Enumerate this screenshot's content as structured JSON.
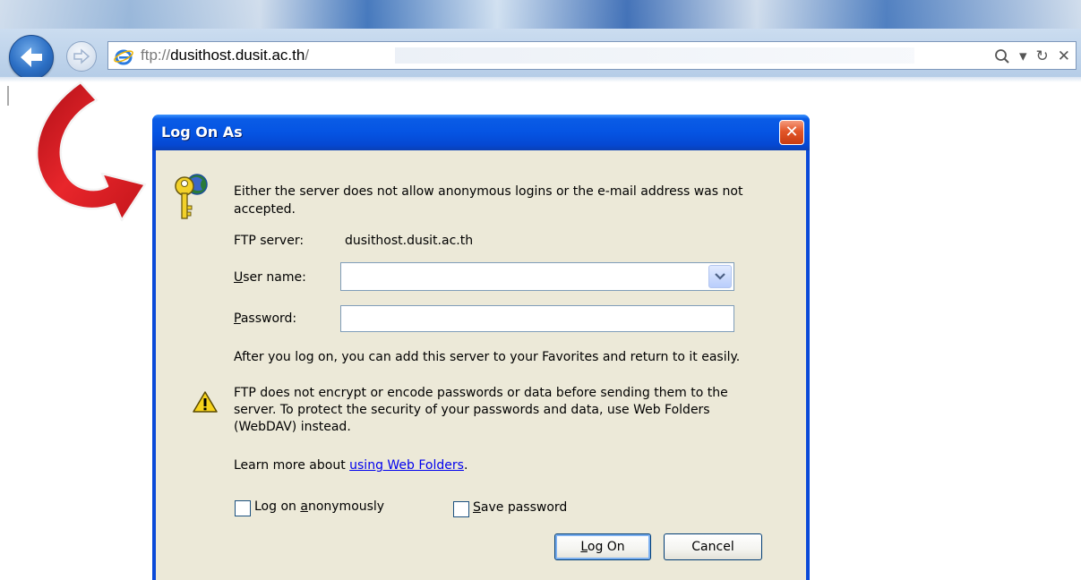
{
  "browser": {
    "url_scheme": "ftp://",
    "url_host": "dusithost.dusit.ac.th",
    "url_path": "/",
    "search_icon": "search-icon",
    "dropdown_glyph": "▾",
    "refresh_glyph": "↻",
    "stop_glyph": "✕"
  },
  "dialog": {
    "title": "Log On As",
    "close_glyph": "✕",
    "intro_line1": "Either the server does not allow anonymous logins or the e-mail address was not",
    "intro_line2": "accepted.",
    "ftp_server_label": "FTP server:",
    "ftp_server_value": "dusithost.dusit.ac.th",
    "user_name_label_u": "U",
    "user_name_label_rest": "ser name:",
    "user_name_value": "",
    "password_label_u": "P",
    "password_label_rest": "assword:",
    "password_value": "",
    "after_logon": "After you log on, you can add this server to your Favorites and return to it easily.",
    "warning_line1": "FTP does not encrypt or encode passwords or data before sending them to the",
    "warning_line2": "server.  To protect the security of your passwords and data, use Web Folders",
    "warning_line3": "(WebDAV) instead.",
    "learn_more_prefix": "Learn more about ",
    "learn_more_link": "using Web Folders",
    "learn_more_suffix": ".",
    "anon_label_pre": "Log on ",
    "anon_label_u": "a",
    "anon_label_post": "nonymously",
    "save_label_u": "S",
    "save_label_post": "ave password",
    "logon_button_u": "L",
    "logon_button_post": "og On",
    "cancel_button": "Cancel"
  },
  "colors": {
    "titlebar": "#0554e3",
    "dialog_body": "#ece9d8",
    "arrow": "#d4141a",
    "link": "#0000ee"
  }
}
